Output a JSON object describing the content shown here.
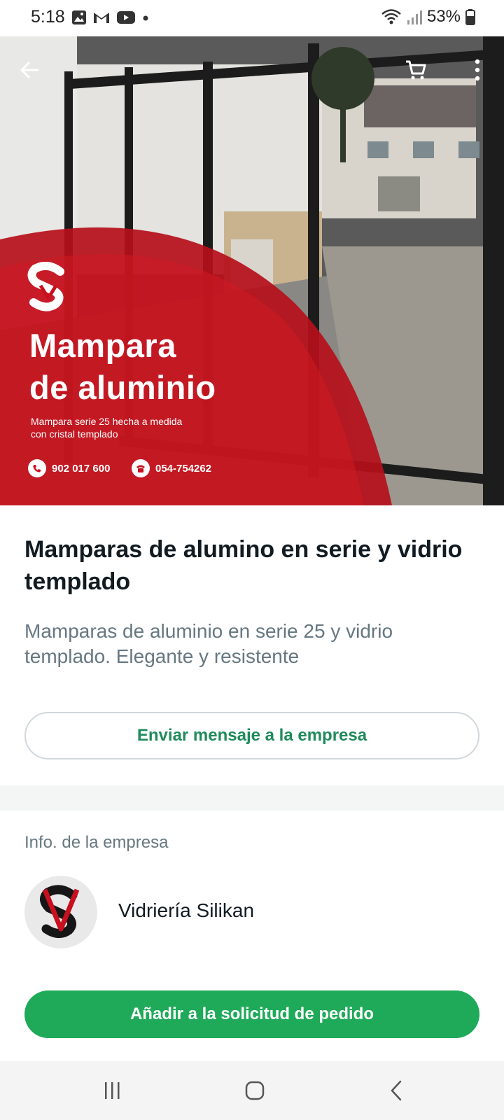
{
  "status_bar": {
    "time": "5:18",
    "battery": "53%",
    "icons_left": [
      "gallery-icon",
      "gmail-icon",
      "youtube-icon",
      "dot-icon"
    ],
    "icons_right": [
      "wifi-icon",
      "signal-icon",
      "battery-icon"
    ]
  },
  "hero": {
    "title_line1": "Mampara",
    "title_line2": "de aluminio",
    "subtitle_line1": "Mampara serie 25 hecha a medida",
    "subtitle_line2": "con cristal templado",
    "phone1": "902 017 600",
    "phone2": "054-754262",
    "icons": [
      "back-arrow-icon",
      "cart-icon",
      "more-vert-icon"
    ]
  },
  "product": {
    "title": "Mamparas de alumino en serie y vidrio templado",
    "description": "Mamparas de aluminio en serie 25 y vidrio templado. Elegante y resistente"
  },
  "actions": {
    "message_label": "Enviar mensaje a la empresa",
    "add_label": "Añadir a la solicitud de pedido"
  },
  "company": {
    "section_label": "Info. de la empresa",
    "name": "Vidriería Silikan"
  },
  "colors": {
    "accent_green": "#1faa59",
    "link_green": "#1f8a5a",
    "brand_red": "#c8101e"
  }
}
